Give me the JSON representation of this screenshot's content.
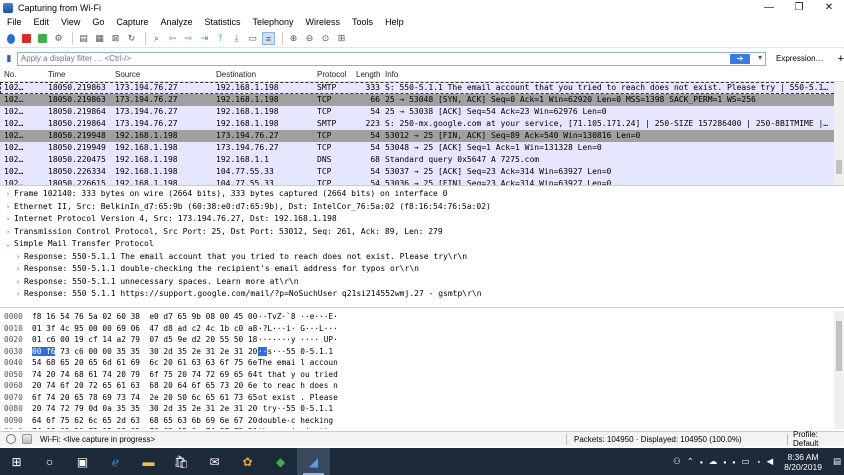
{
  "window": {
    "title": "Capturing from Wi-Fi"
  },
  "menu": [
    "File",
    "Edit",
    "View",
    "Go",
    "Capture",
    "Analyze",
    "Statistics",
    "Telephony",
    "Wireless",
    "Tools",
    "Help"
  ],
  "filter": {
    "placeholder": "Apply a display filter … <Ctrl-/>",
    "expression_label": "Expression…",
    "plus_label": "+"
  },
  "packet_list": {
    "columns": [
      "No.",
      "Time",
      "Source",
      "Destination",
      "Protocol",
      "Length",
      "Info"
    ],
    "rows": [
      {
        "no": "102…",
        "time": "18050.219863",
        "src": "173.194.76.27",
        "dst": "192.168.1.198",
        "proto": "SMTP",
        "len": "333",
        "info": "S: 550-5.1.1 The email account that you tried to reach does not exist. Please try | 550-5.1…",
        "style": "row-sel"
      },
      {
        "no": "102…",
        "time": "18050.219863",
        "src": "173.194.76.27",
        "dst": "192.168.1.198",
        "proto": "TCP",
        "len": "66",
        "info": "25 → 53048 [SYN, ACK] Seq=0 Ack=1 Win=62920 Len=0 MSS=1398 SACK_PERM=1 WS=256",
        "style": "row-gray"
      },
      {
        "no": "102…",
        "time": "18050.219864",
        "src": "173.194.76.27",
        "dst": "192.168.1.198",
        "proto": "TCP",
        "len": "54",
        "info": "25 → 53038 [ACK] Seq=54 Ack=23 Win=62976 Len=0",
        "style": "row-blue"
      },
      {
        "no": "102…",
        "time": "18050.219864",
        "src": "173.194.76.27",
        "dst": "192.168.1.198",
        "proto": "SMTP",
        "len": "223",
        "info": "S: 250-mx.google.com at your service, [71.105.171.24] | 250-SIZE 157286400 | 250-8BITMIME |…",
        "style": "row-blue"
      },
      {
        "no": "102…",
        "time": "18050.219948",
        "src": "192.168.1.198",
        "dst": "173.194.76.27",
        "proto": "TCP",
        "len": "54",
        "info": "53012 → 25 [FIN, ACK] Seq=89 Ack=540 Win=130816 Len=0",
        "style": "row-gray"
      },
      {
        "no": "102…",
        "time": "18050.219949",
        "src": "192.168.1.198",
        "dst": "173.194.76.27",
        "proto": "TCP",
        "len": "54",
        "info": "53048 → 25 [ACK] Seq=1 Ack=1 Win=131328 Len=0",
        "style": "row-blue"
      },
      {
        "no": "102…",
        "time": "18050.220475",
        "src": "192.168.1.198",
        "dst": "192.168.1.1",
        "proto": "DNS",
        "len": "68",
        "info": "Standard query 0x5647 A 7275.com",
        "style": "row-blue"
      },
      {
        "no": "102…",
        "time": "18050.226334",
        "src": "192.168.1.198",
        "dst": "104.77.55.33",
        "proto": "TCP",
        "len": "54",
        "info": "53037 → 25 [ACK] Seq=23 Ack=314 Win=63927 Len=0",
        "style": "row-blue"
      },
      {
        "no": "102…",
        "time": "18050.226615",
        "src": "192.168.1.198",
        "dst": "104.77.55.33",
        "proto": "TCP",
        "len": "54",
        "info": "53036 → 25 [FIN] Seq=23 Ack=314 Win=63927 Len=0",
        "style": "row-blue"
      }
    ]
  },
  "details": [
    {
      "text": "Frame 102140: 333 bytes on wire (2664 bits), 333 bytes captured (2664 bits) on interface 0",
      "twist": ">",
      "level": 0
    },
    {
      "text": "Ethernet II, Src: BelkinIn_d7:65:9b (60:38:e0:d7:65:9b), Dst: IntelCor_76:5a:02 (f8:16:54:76:5a:02)",
      "twist": ">",
      "level": 0
    },
    {
      "text": "Internet Protocol Version 4, Src: 173.194.76.27, Dst: 192.168.1.198",
      "twist": ">",
      "level": 0
    },
    {
      "text": "Transmission Control Protocol, Src Port: 25, Dst Port: 53012, Seq: 261, Ack: 89, Len: 279",
      "twist": ">",
      "level": 0
    },
    {
      "text": "Simple Mail Transfer Protocol",
      "twist": "v",
      "level": 0
    },
    {
      "text": "Response: 550-5.1.1 The email account that you tried to reach does not exist. Please try\\r\\n",
      "twist": ">",
      "level": 1
    },
    {
      "text": "Response: 550-5.1.1 double-checking the recipient's email address for typos or\\r\\n",
      "twist": ">",
      "level": 1
    },
    {
      "text": "Response: 550-5.1.1 unnecessary spaces. Learn more at\\r\\n",
      "twist": ">",
      "level": 1
    },
    {
      "text": "Response: 550 5.1.1  https://support.google.com/mail/?p=NoSuchUser q21si214552wmj.27 - gsmtp\\r\\n",
      "twist": ">",
      "level": 1
    }
  ],
  "hex_dump": [
    {
      "off": "0000",
      "pre": "",
      "hl": "",
      "bytes": "f8 16 54 76 5a 02 60 38  e0 d7 65 9b 08 00 45 00",
      "ascii": "··TvZ·`8 ··e···E·"
    },
    {
      "off": "0010",
      "pre": "",
      "hl": "",
      "bytes": "01 3f 4c 95 00 00 69 06  47 d8 ad c2 4c 1b c0 a8",
      "ascii": "·?L···i· G···L···"
    },
    {
      "off": "0020",
      "pre": "",
      "hl": "",
      "bytes": "01 c6 00 19 cf 14 a2 79  07 d5 9e d2 20 55 50 18",
      "ascii": "·······y ···· UP·"
    },
    {
      "off": "0030",
      "pre": "",
      "hl": "00 f6",
      "bytes": " 73 c6 00 00 35 35  30 2d 35 2e 31 2e 31 20",
      "ascii_hl": "··",
      "ascii": "s···55 0-5.1.1 "
    },
    {
      "off": "0040",
      "pre": "",
      "hl": "",
      "bytes": "54 68 65 20 65 6d 61 69  6c 20 61 63 63 6f 75 6e",
      "ascii": "The emai l accoun"
    },
    {
      "off": "0050",
      "pre": "",
      "hl": "",
      "bytes": "74 20 74 68 61 74 20 79  6f 75 20 74 72 69 65 64",
      "ascii": "t that y ou tried"
    },
    {
      "off": "0060",
      "pre": "",
      "hl": "",
      "bytes": "20 74 6f 20 72 65 61 63  68 20 64 6f 65 73 20 6e",
      "ascii": " to reac h does n"
    },
    {
      "off": "0070",
      "pre": "",
      "hl": "",
      "bytes": "6f 74 20 65 78 69 73 74  2e 20 50 6c 65 61 73 65",
      "ascii": "ot exist . Please"
    },
    {
      "off": "0080",
      "pre": "",
      "hl": "",
      "bytes": "20 74 72 79 0d 0a 35 35  30 2d 35 2e 31 2e 31 20",
      "ascii": " try··55 0-5.1.1 "
    },
    {
      "off": "0090",
      "pre": "",
      "hl": "",
      "bytes": "64 6f 75 62 6c 65 2d 63  68 65 63 6b 69 6e 67 20",
      "ascii": "double-c hecking "
    },
    {
      "off": "00a0",
      "pre": "",
      "hl": "",
      "bytes": "74 68 65 20 72 65 63 69  70 69 65 6e 74 27 73 20",
      "ascii": "the reci pient's "
    }
  ],
  "status": {
    "interface": "Wi-Fi: <live capture in progress>",
    "packets": "Packets: 104950 · Displayed: 104950 (100.0%)",
    "profile": "Profile: Default"
  },
  "taskbar": {
    "time": "8:36 AM",
    "date": "8/20/2019"
  },
  "colors": {
    "row_blue": "#e7e6ff",
    "row_gray": "#a0a0a0",
    "highlight": "#2f6fd6",
    "taskbar": "#1d2a3a"
  }
}
